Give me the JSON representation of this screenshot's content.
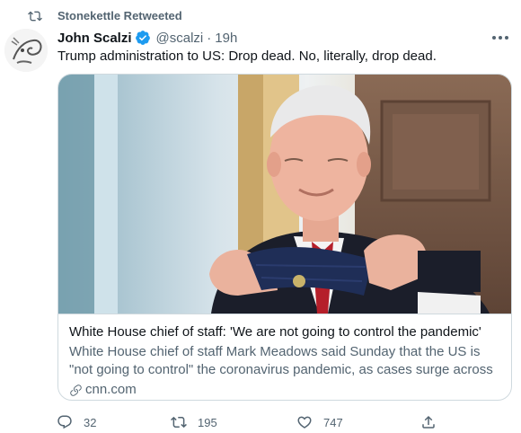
{
  "retweet_context": {
    "label": "Stonekettle Retweeted",
    "icon": "retweet-icon"
  },
  "author": {
    "display_name": "John Scalzi",
    "verified": true,
    "handle": "@scalzi",
    "separator": "·",
    "time": "19h"
  },
  "tweet": {
    "text": "Trump administration to US: Drop dead. No, literally, drop dead."
  },
  "card": {
    "image": "photo-man-holding-mask",
    "title": "White House chief of staff: 'We are not going to control the pandemic'",
    "description": "White House chief of staff Mark Meadows said Sunday that the US is \"not going to control\" the coronavirus pandemic, as cases surge across the ...",
    "domain": "cnn.com",
    "domain_icon": "link-icon"
  },
  "actions": {
    "reply_count": "32",
    "retweet_count": "195",
    "like_count": "747"
  },
  "colors": {
    "text_primary": "#0f1419",
    "text_secondary": "#536471",
    "border": "#cfd9de",
    "verified": "#1d9bf0"
  }
}
